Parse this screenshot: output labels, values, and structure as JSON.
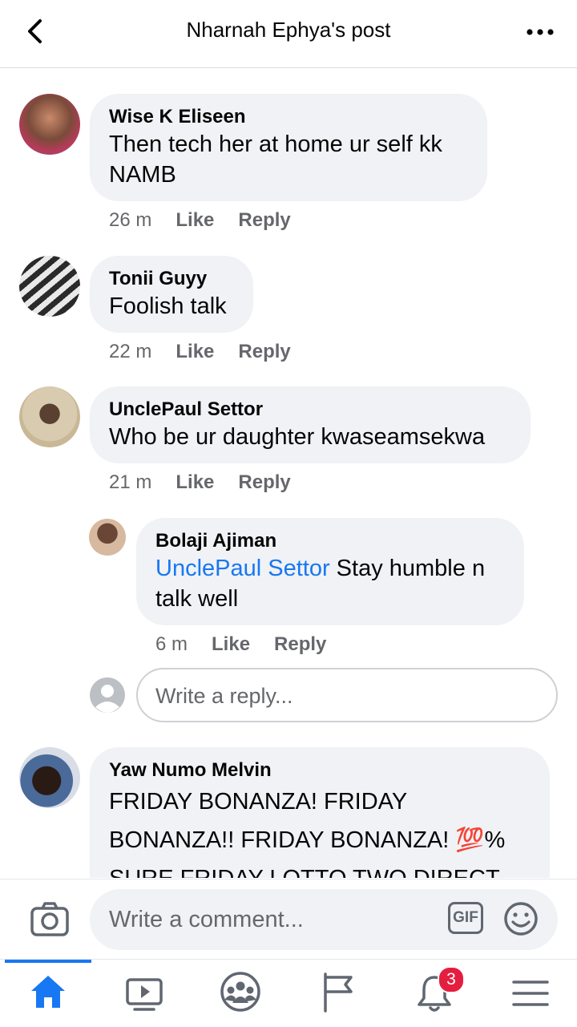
{
  "header": {
    "title": "Nharnah Ephya's post"
  },
  "comments": [
    {
      "name": "Wise K Eliseen",
      "lines": [
        "Then tech her at home ur self kk",
        "NAMB"
      ],
      "time": "26 m",
      "like": "Like",
      "reply": "Reply"
    },
    {
      "name": "Tonii Guyy",
      "lines": [
        "Foolish talk"
      ],
      "time": "22 m",
      "like": "Like",
      "reply": "Reply"
    },
    {
      "name": "UnclePaul Settor",
      "lines": [
        "Who be ur daughter kwaseamsekwa"
      ],
      "time": "21 m",
      "like": "Like",
      "reply": "Reply"
    },
    {
      "name": "Yaw Numo Melvin",
      "lines": [
        "FRIDAY BONANZA! FRIDAY",
        "BONANZA!! FRIDAY BONANZA! 💯%",
        "SURE FRIDAY  LOTTO TWO DIRECT"
      ]
    }
  ],
  "reply": {
    "name": "Bolaji Ajiman",
    "mention": "UnclePaul Settor",
    "line1_rest": " Stay humble n",
    "line2": "talk well",
    "time": "6 m",
    "like": "Like",
    "reply": "Reply"
  },
  "reply_input": {
    "placeholder": "Write a reply..."
  },
  "composer": {
    "placeholder": "Write a comment...",
    "gif_label": "GIF"
  },
  "tabs": {
    "notifications_badge": "3",
    "active": "home"
  },
  "colors": {
    "accent": "#1877f2",
    "bubble": "#f0f2f5",
    "meta": "#65676b",
    "badge": "#e41e3f"
  }
}
